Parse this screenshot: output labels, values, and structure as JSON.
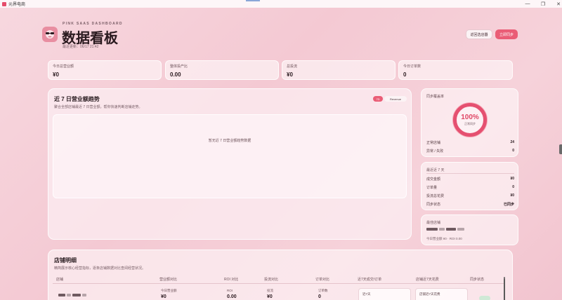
{
  "window": {
    "app_name": "元界电商",
    "controls": {
      "min": "—",
      "max": "❐",
      "close": "✕"
    }
  },
  "header": {
    "brand_sub": "PINK SAAS DASHBOARD",
    "title": "数据看板",
    "updated": "最近更新：06/17 21:42",
    "btn_light": "返回选店器",
    "btn_primary": "立即同步"
  },
  "stats": [
    {
      "label": "今日总营业额",
      "value": "¥0"
    },
    {
      "label": "整体投产比",
      "value": "0.00"
    },
    {
      "label": "总投流",
      "value": "¥0"
    },
    {
      "label": "今日订单数",
      "value": "0"
    }
  ],
  "trend": {
    "title": "近 7 日营业额趋势",
    "subtitle": "聚合全部店铺最近 7 日营业额，帮你快速判断店铺走势。",
    "pill_7": "7D",
    "pill_revenue": "Revenue",
    "empty_text": "暂无近 7 日营业额趋势数据"
  },
  "sync_card": {
    "header": "同步覆盖率",
    "percent": "100%",
    "percent_label": "正常同步",
    "rows": [
      {
        "label": "正常店铺",
        "value": "24"
      },
      {
        "label": "异常 / 失败",
        "value": "0"
      }
    ]
  },
  "recent_card": {
    "header": "最近近 7 天",
    "rows": [
      {
        "label": "成交金额",
        "value": "¥0"
      },
      {
        "label": "订单量",
        "value": "0"
      },
      {
        "label": "投流总花费",
        "value": "¥0"
      },
      {
        "label": "同步状态",
        "value": "已同步"
      }
    ]
  },
  "best_card": {
    "header": "最佳店铺",
    "sub": "今日营业额 ¥0 · ROI 0.00"
  },
  "stores": {
    "title": "店铺明细",
    "subtitle": "精简展示核心经营指标，逐条店铺数据对比查阅经营状况。",
    "columns": [
      "店铺",
      "营业额对比",
      "ROI 对比",
      "投流对比",
      "订单对比",
      "近7天成交/订单",
      "店铺近7天花费",
      "同步状态"
    ],
    "row": {
      "revenue_label": "今日营业额",
      "revenue_value": "¥0",
      "roi_label": "ROI",
      "roi_value": "0.00",
      "ads_label": "投流",
      "ads_value": "¥0",
      "orders_label": "订单数",
      "orders_value": "0",
      "card1_label": "近7天",
      "card2_label": "店铺近7天花费"
    }
  }
}
